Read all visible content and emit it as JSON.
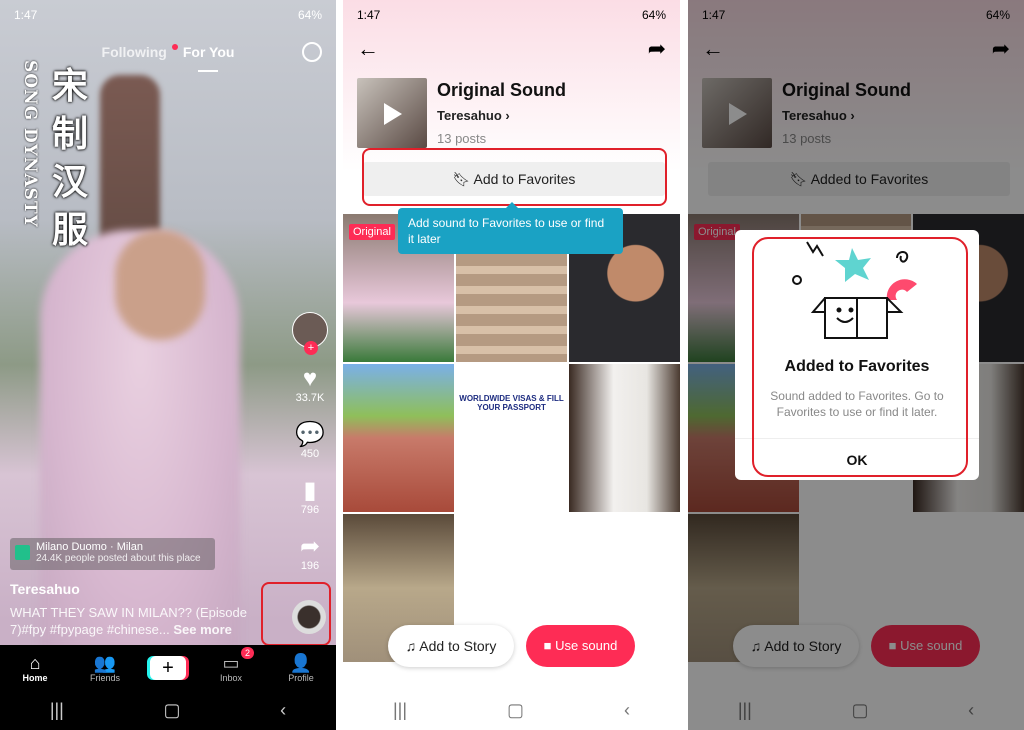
{
  "status": {
    "time": "1:47",
    "battery": "64%"
  },
  "feed": {
    "tabs": [
      "Following",
      "For You"
    ],
    "overlay_cn": "宋制汉服",
    "overlay_en": "SONG DYNASTY",
    "likes": "33.7K",
    "comments": "450",
    "saves": "796",
    "shares": "196",
    "location": {
      "name": "Milano Duomo · Milan",
      "sub": "24.4K people posted about this place"
    },
    "username": "Teresahuo",
    "caption": "WHAT THEY SAW IN MILAN?? (Episode 7)#fpy #fpypage #chinese...",
    "see_more": "See more",
    "nav": [
      {
        "label": "Home",
        "icon": "home-icon"
      },
      {
        "label": "Friends",
        "icon": "friends-icon"
      },
      {
        "label": "",
        "icon": "plus-icon"
      },
      {
        "label": "Inbox",
        "icon": "inbox-icon",
        "badge": "2"
      },
      {
        "label": "Profile",
        "icon": "profile-icon"
      }
    ]
  },
  "sound": {
    "title": "Original Sound",
    "author": "Teresahuo",
    "posts": "13 posts",
    "fav_label": "Add to Favorites",
    "faved_label": "Added to Favorites",
    "original_tag": "Original",
    "tooltip": "Add sound to Favorites to use or find it later",
    "visa_text": "WORLDWIDE VISAS & FILL YOUR PASSPORT",
    "add_story": "Add to Story",
    "use_sound": "Use sound"
  },
  "dialog": {
    "title": "Added to Favorites",
    "body": "Sound added to Favorites. Go to Favorites to use or find it later.",
    "ok": "OK"
  },
  "colors": {
    "accent": "#fe2c55",
    "tooltip": "#1aa2c4",
    "highlight": "#e0202a"
  }
}
